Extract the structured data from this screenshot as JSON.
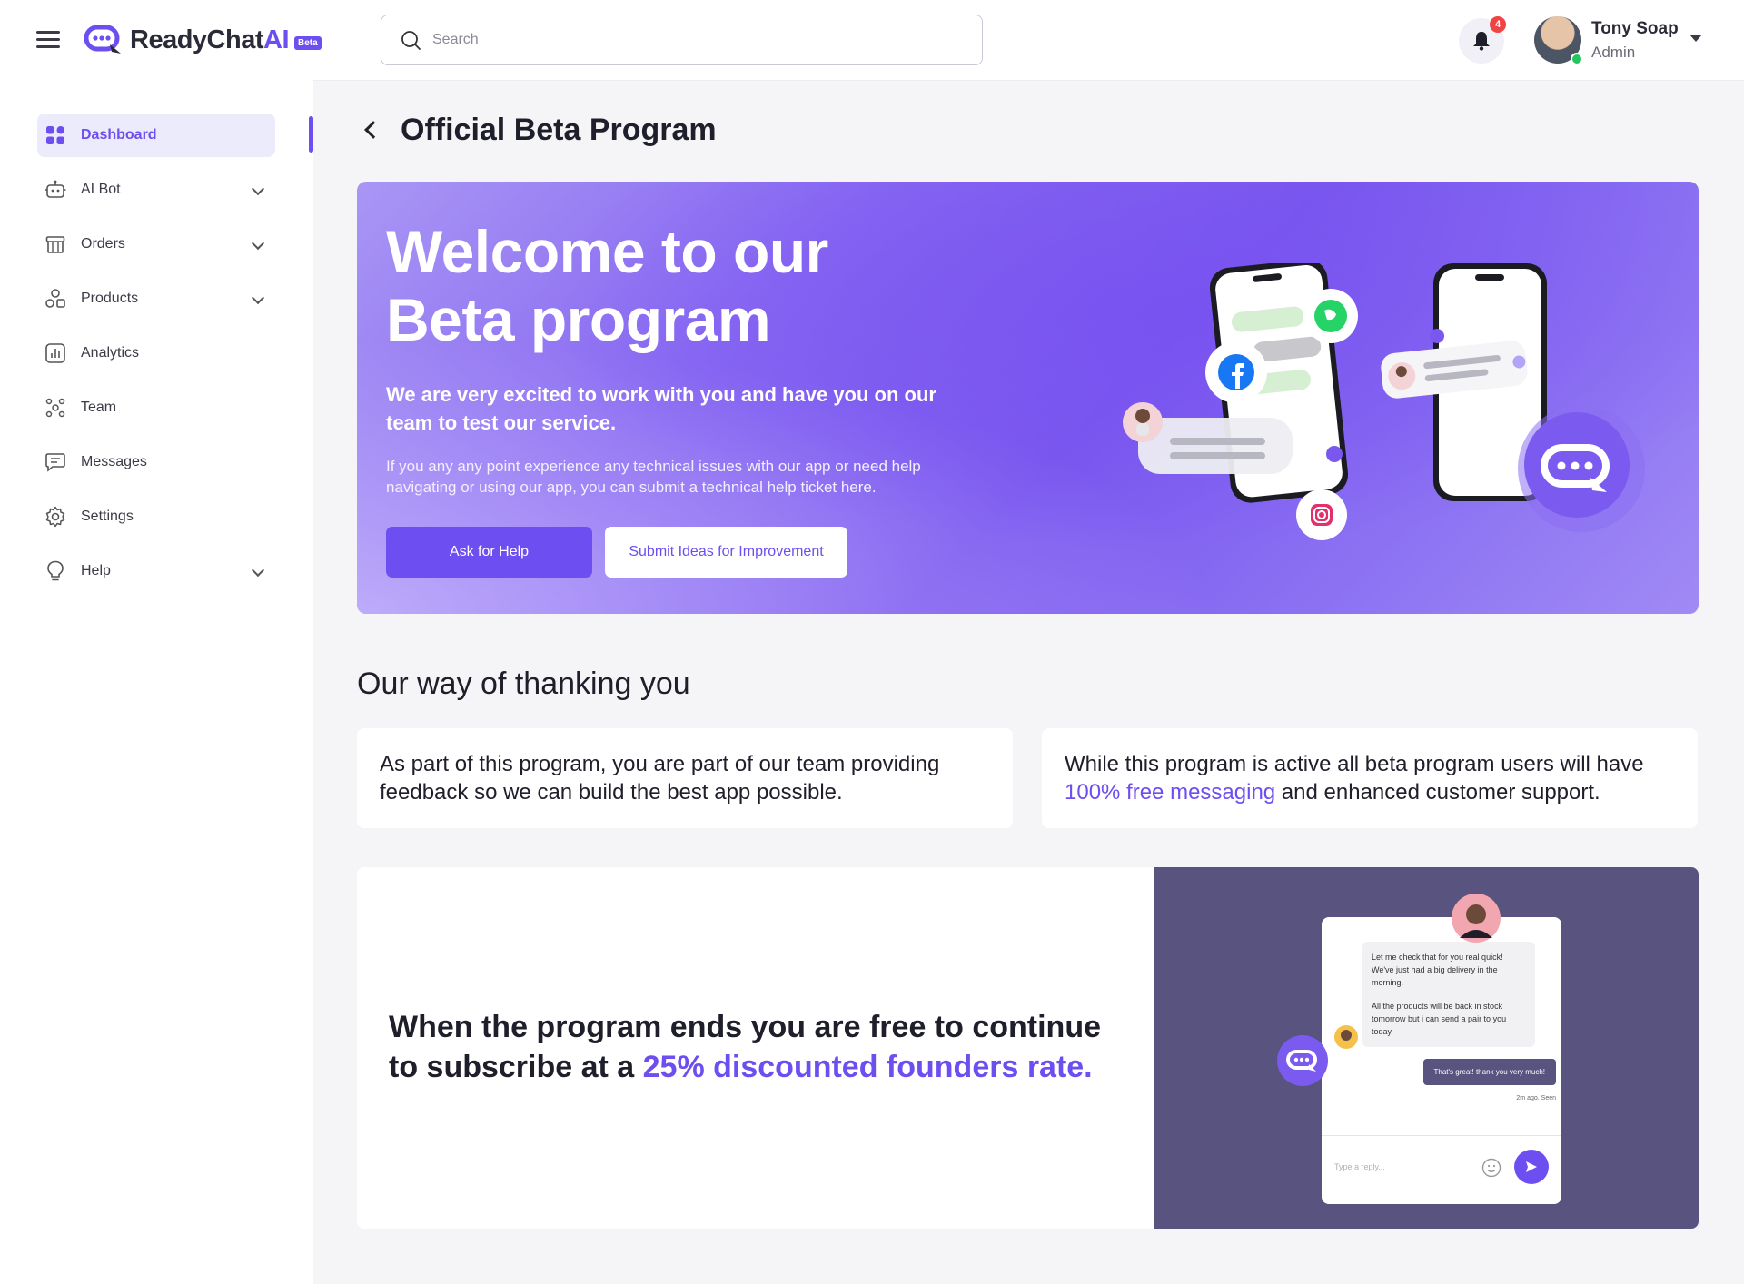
{
  "app": {
    "logo_main": "ReadyChat",
    "logo_ai": "AI",
    "logo_badge": "Beta"
  },
  "search": {
    "placeholder": "Search"
  },
  "notifications": {
    "count": "4"
  },
  "user": {
    "name": "Tony Soap",
    "role": "Admin"
  },
  "sidebar": {
    "items": [
      {
        "label": "Dashboard",
        "icon": "dashboard-icon"
      },
      {
        "label": "AI Bot",
        "icon": "robot-icon"
      },
      {
        "label": "Orders",
        "icon": "orders-icon"
      },
      {
        "label": "Products",
        "icon": "products-icon"
      },
      {
        "label": "Analytics",
        "icon": "analytics-icon"
      },
      {
        "label": "Team",
        "icon": "team-icon"
      },
      {
        "label": "Messages",
        "icon": "message-icon"
      },
      {
        "label": "Settings",
        "icon": "gear-icon"
      },
      {
        "label": "Help",
        "icon": "lightbulb-icon"
      }
    ]
  },
  "page": {
    "title": "Official Beta Program"
  },
  "hero": {
    "title_line1": "Welcome to our",
    "title_line2": "Beta program",
    "subtitle": "We are very excited to work with you and have you on our team to test our service.",
    "body": "If you any any point experience any technical issues with our app or need help navigating or using our app, you can submit a technical help ticket here.",
    "btn_help": "Ask for Help",
    "btn_ideas": "Submit Ideas for Improvement"
  },
  "thanks": {
    "title": "Our way of thanking you",
    "card1": "As part of this program, you are part of our team providing feedback so we can build the best app possible.",
    "card2_pre": "While this program is active all beta program users will have ",
    "card2_accent": "100% free messaging",
    "card2_post": " and enhanced customer support."
  },
  "discount": {
    "text_pre": "When the program ends you are free to continue to subscribe at a ",
    "text_accent": "25% discounted founders rate."
  },
  "chat_preview": {
    "msg1_a": "Let me check that for you real quick! We've just had a big delivery in the morning.",
    "msg1_b": "All the products will be back in stock tomorrow but i can send a pair to you today.",
    "reply": "That's great! thank you very much!",
    "meta": "2m ago. Seen",
    "input_placeholder": "Type a reply..."
  },
  "colors": {
    "accent": "#6d4ef0",
    "art_bg": "#58537f"
  }
}
